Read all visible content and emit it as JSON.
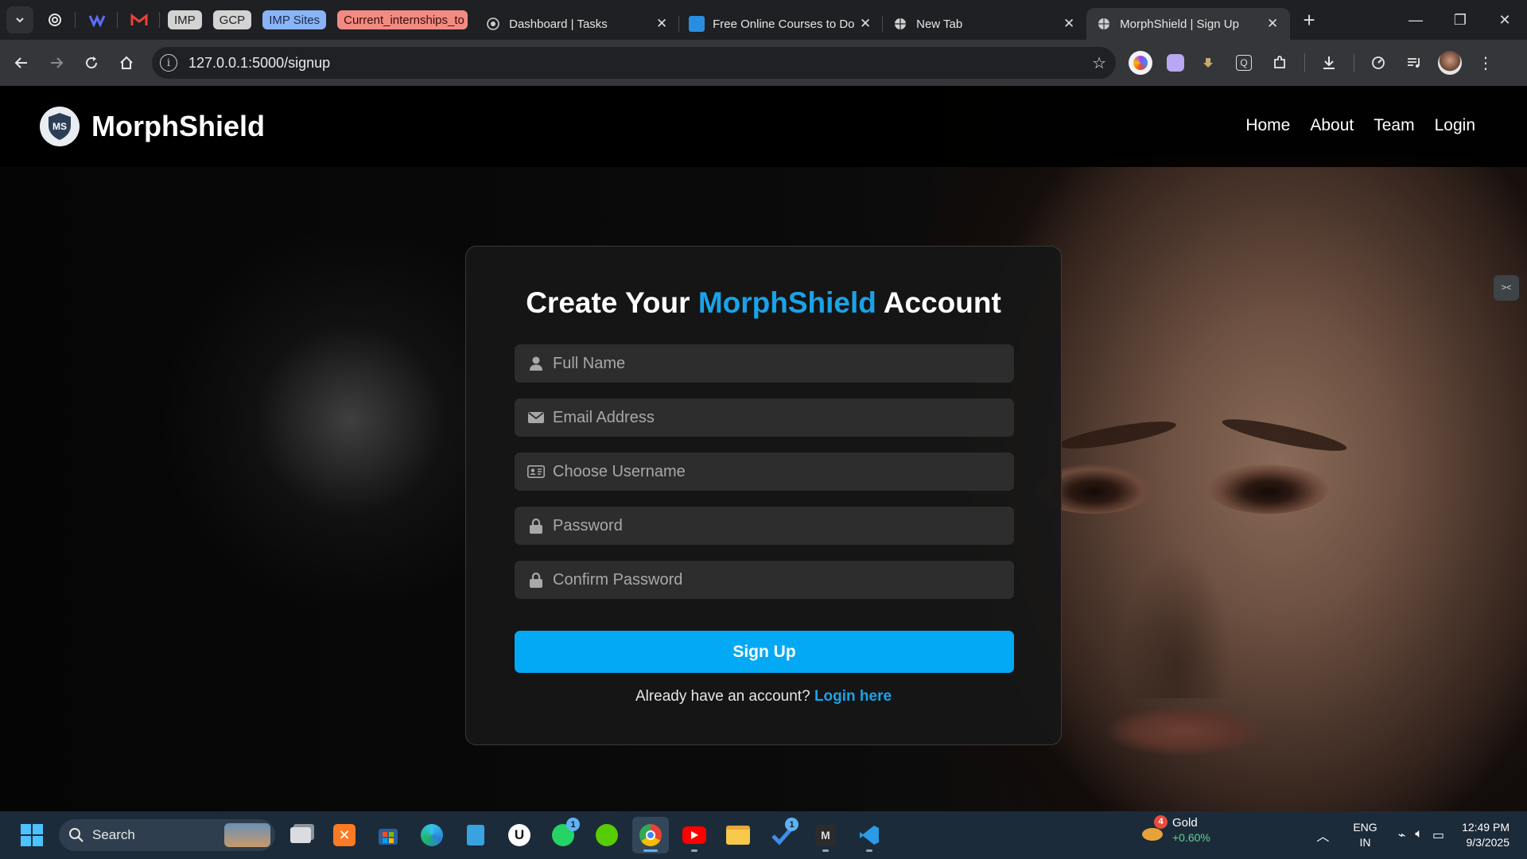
{
  "browser": {
    "bookmarks": [
      "IMP",
      "GCP",
      "IMP Sites",
      "Current_internships_to"
    ],
    "tabs": [
      {
        "title": "Dashboard | Tasks"
      },
      {
        "title": "Free Online Courses to Do"
      },
      {
        "title": "New Tab"
      },
      {
        "title": "MorphShield | Sign Up",
        "active": true
      }
    ],
    "url": "127.0.0.1:5000/signup",
    "colors": {
      "tabstrip": "#1f2023",
      "toolbar": "#35363a",
      "omnibox": "#202124"
    }
  },
  "site": {
    "brand": "MorphShield",
    "logo_text": "MS",
    "nav": [
      "Home",
      "About",
      "Team",
      "Login"
    ],
    "form": {
      "title_prefix": "Create Your",
      "title_accent": "MorphShield",
      "title_suffix": "Account",
      "fields": [
        {
          "icon": "user-icon",
          "placeholder": "Full Name"
        },
        {
          "icon": "envelope-icon",
          "placeholder": "Email Address"
        },
        {
          "icon": "id-card-icon",
          "placeholder": "Choose Username"
        },
        {
          "icon": "lock-icon",
          "placeholder": "Password"
        },
        {
          "icon": "lock-icon",
          "placeholder": "Confirm Password"
        }
      ],
      "submit_label": "Sign Up",
      "login_prompt": "Already have an account?",
      "login_link": "Login here"
    },
    "colors": {
      "accent": "#1aa3e8",
      "button": "#03a9f4",
      "card": "#161616",
      "field": "#2d2d2d"
    }
  },
  "taskbar": {
    "search_label": "Search",
    "apps": [
      {
        "name": "task-view"
      },
      {
        "name": "xampp"
      },
      {
        "name": "microsoft-store"
      },
      {
        "name": "edge"
      },
      {
        "name": "notepad"
      },
      {
        "name": "upwork"
      },
      {
        "name": "whatsapp",
        "badge": "1"
      },
      {
        "name": "duolingo"
      },
      {
        "name": "chrome"
      },
      {
        "name": "youtube"
      },
      {
        "name": "file-explorer"
      },
      {
        "name": "todo",
        "badge": "1"
      },
      {
        "name": "m-app"
      },
      {
        "name": "vscode"
      }
    ],
    "weather": {
      "badge": "4",
      "name": "Gold",
      "value": "+0.60%"
    },
    "language": [
      "ENG",
      "IN"
    ],
    "time": "12:49 PM",
    "date": "9/3/2025"
  }
}
